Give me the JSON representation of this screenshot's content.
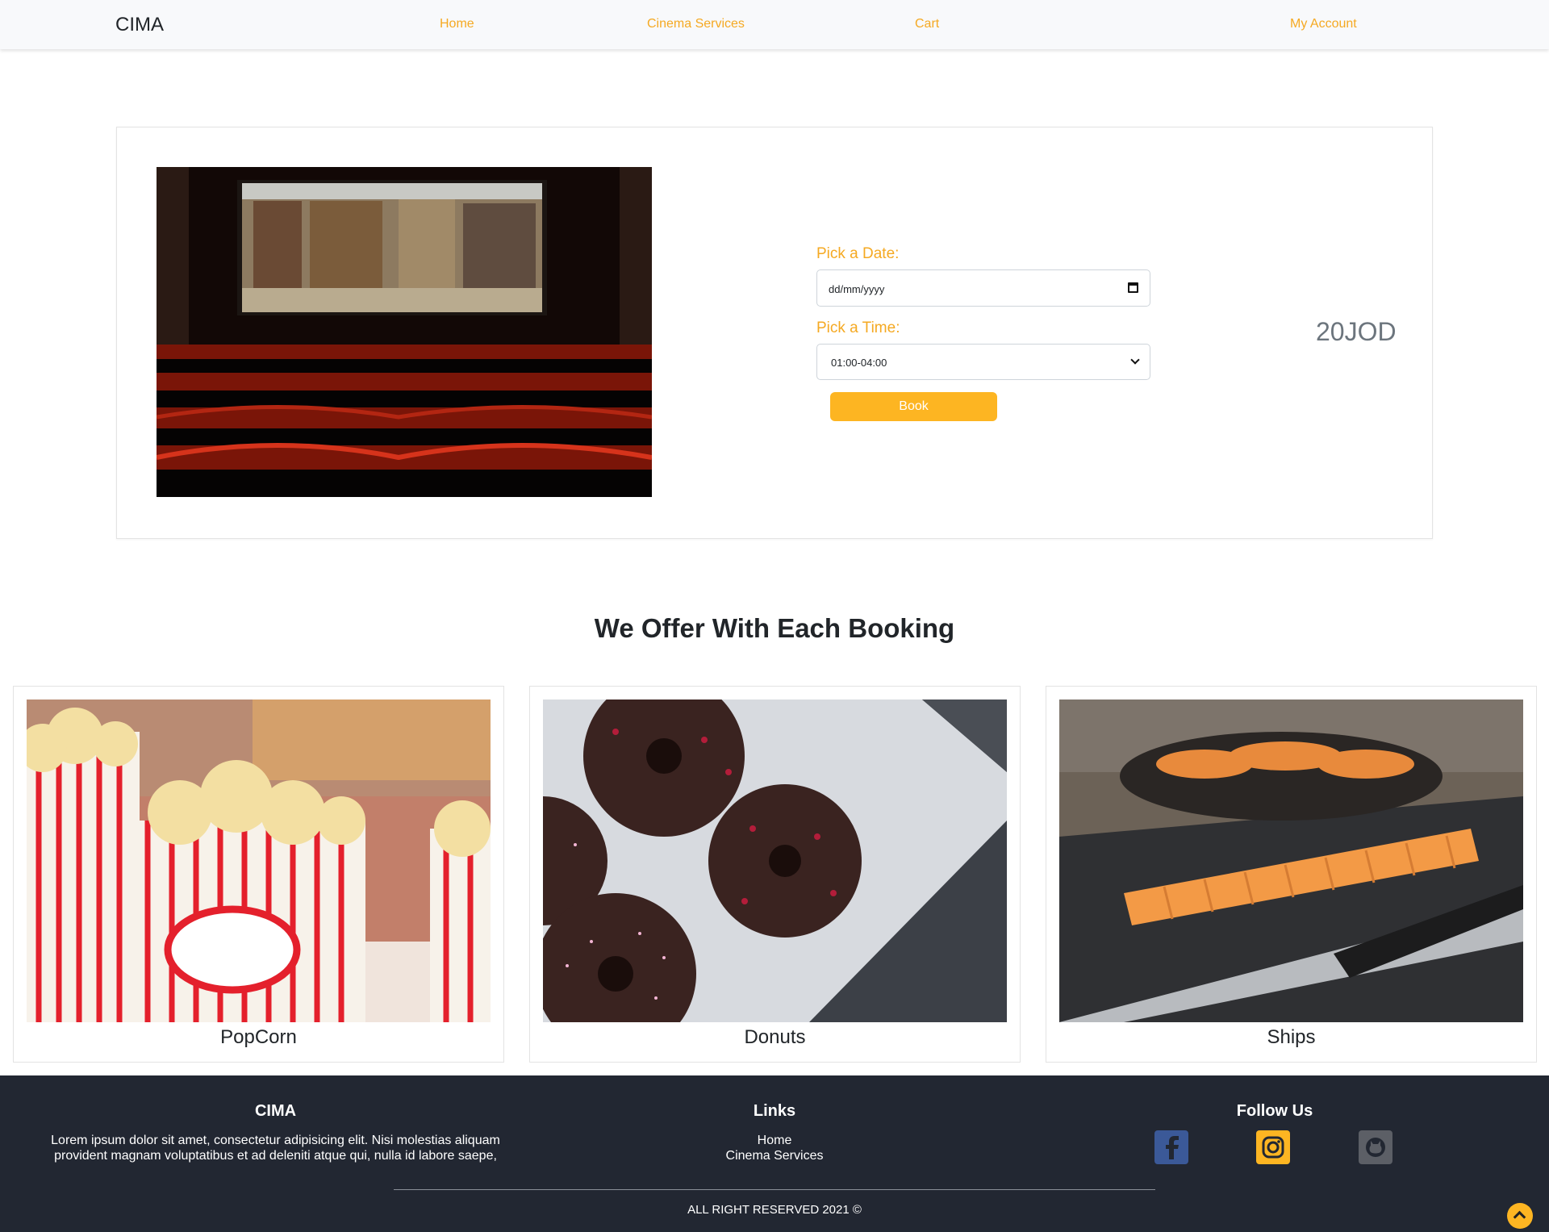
{
  "navbar": {
    "brand": "CIMA",
    "links": [
      "Home",
      "Cinema Services",
      "Cart",
      "My Account"
    ]
  },
  "booking": {
    "date_label": "Pick a Date:",
    "date_placeholder": "dd/mm/yyyy",
    "time_label": "Pick a Time:",
    "time_value": "01:00-04:00",
    "book_label": "Book",
    "price": "20JOD"
  },
  "offers": {
    "title": "We Offer With Each Booking",
    "items": [
      "PopCorn",
      "Donuts",
      "Ships"
    ]
  },
  "footer": {
    "about_title": "CIMA",
    "about_text_1": "Lorem ipsum dolor sit amet, consectetur adipisicing elit. Nisi molestias aliquam",
    "about_text_2": "provident magnam voluptatibus et ad deleniti atque qui, nulla id labore saepe,",
    "links_title": "Links",
    "links": [
      "Home",
      "Cinema Services"
    ],
    "follow_title": "Follow Us",
    "social_icons": [
      "facebook-icon",
      "instagram-icon",
      "github-icon"
    ],
    "copyright": "ALL RIGHT RESERVED 2021 ©"
  },
  "colors": {
    "accent": "#fdb522",
    "footer_bg": "#222732"
  }
}
